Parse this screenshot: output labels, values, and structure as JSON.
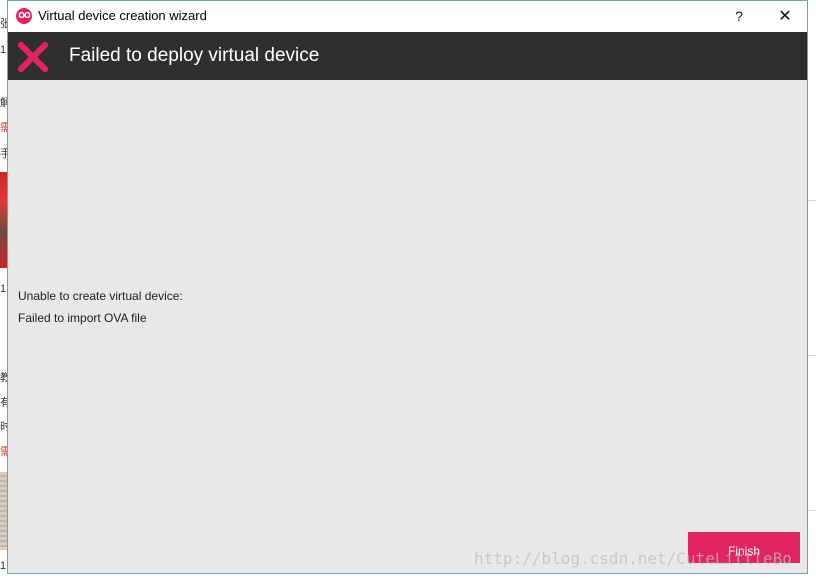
{
  "window": {
    "title": "Virtual device creation wizard",
    "app_icon_glyph": "OO",
    "help_label": "?",
    "close_label": "✕"
  },
  "header": {
    "icon": "failure-x-icon",
    "title": "Failed to deploy virtual device"
  },
  "content": {
    "message_line1": "Unable to create virtual device:",
    "message_line2": "Failed to import OVA file"
  },
  "footer": {
    "finish_label": "Finish"
  },
  "watermark": "http://blog.csdn.net/CuteLittleBo",
  "colors": {
    "accent": "#e2245f",
    "header_bg": "#2f2f2f",
    "content_bg": "#e8e8e8"
  }
}
